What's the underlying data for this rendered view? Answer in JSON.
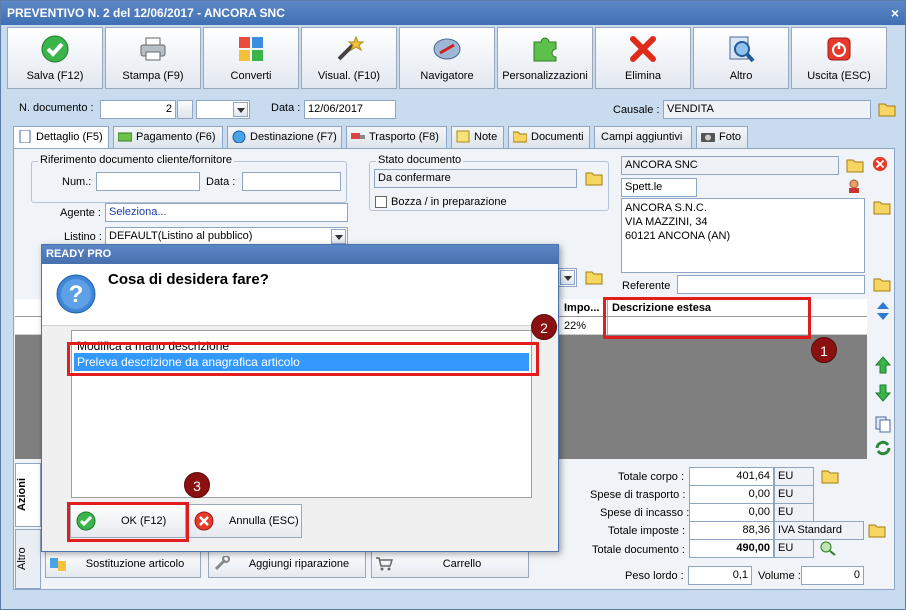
{
  "window": {
    "title": "PREVENTIVO N. 2 del 12/06/2017 - ANCORA SNC",
    "close_glyph": "×"
  },
  "toolbar": [
    {
      "name": "salva-button",
      "label": "Salva (F12)",
      "icon": "check-icon"
    },
    {
      "name": "stampa-button",
      "label": "Stampa (F9)",
      "icon": "printer-icon"
    },
    {
      "name": "converti-button",
      "label": "Converti",
      "icon": "convert-icon"
    },
    {
      "name": "visual-button",
      "label": "Visual. (F10)",
      "icon": "magic-wand-icon"
    },
    {
      "name": "navigatore-button",
      "label": "Navigatore",
      "icon": "compass-icon"
    },
    {
      "name": "personalizzazioni-button",
      "label": "Personalizzazioni",
      "icon": "puzzle-icon"
    },
    {
      "name": "elimina-button",
      "label": "Elimina",
      "icon": "red-x-icon"
    },
    {
      "name": "altro-button",
      "label": "Altro",
      "icon": "magnifier-icon"
    },
    {
      "name": "uscita-button",
      "label": "Uscita (ESC)",
      "icon": "power-icon"
    }
  ],
  "doc": {
    "ndoc_label": "N. documento :",
    "ndoc_value": "2",
    "data_label": "Data :",
    "data_value": "12/06/2017",
    "causale_label": "Causale :",
    "causale_value": "VENDITA"
  },
  "tabs": [
    "Dettaglio (F5)",
    "Pagamento (F6)",
    "Destinazione (F7)",
    "Trasporto (F8)",
    "Note",
    "Documenti",
    "Campi aggiuntivi",
    "Foto"
  ],
  "rif": {
    "title": "Riferimento documento cliente/fornitore",
    "num_label": "Num.:",
    "data_label": "Data :"
  },
  "stato": {
    "title": "Stato documento",
    "value": "Da confermare",
    "bozza_label": "Bozza / in preparazione"
  },
  "agente": {
    "label": "Agente :",
    "value": "Seleziona..."
  },
  "listino": {
    "label": "Listino :",
    "value": "DEFAULT(Listino al pubblico)"
  },
  "cliente": {
    "name": "ANCORA SNC",
    "title": "Spett.le",
    "address_lines": [
      "ANCORA S.N.C.",
      "VIA MAZZINI, 34",
      "60121 ANCONA (AN)"
    ],
    "referente_label": "Referente"
  },
  "grid": {
    "col_impo": "Impo...",
    "col_desc": "Descrizione estesa",
    "impo_value": "22%"
  },
  "totals": [
    {
      "label": "Totale corpo :",
      "value": "401,64",
      "unit": "EU"
    },
    {
      "label": "Spese di trasporto :",
      "value": "0,00",
      "unit": "EU"
    },
    {
      "label": "Spese di incasso :",
      "value": "0,00",
      "unit": "EU"
    },
    {
      "label": "Totale imposte :",
      "value": "88,36",
      "unit": "IVA Standard"
    },
    {
      "label": "Totale documento :",
      "value": "490,00",
      "unit": "EU"
    }
  ],
  "peso": {
    "lordo_label": "Peso lordo :",
    "lordo_value": "0,1",
    "volume_label": "Volume :",
    "volume_value": "0"
  },
  "side_tabs": {
    "azioni": "Azioni",
    "altro": "Altro"
  },
  "actions": {
    "sostituzione": "Sostituzione articolo",
    "riparazione": "Aggiungi riparazione",
    "carrello": "Carrello"
  },
  "markers": {
    "m1": "1",
    "m2": "2",
    "m3": "3"
  },
  "dialog": {
    "title": "READY PRO",
    "question": "Cosa di desidera fare?",
    "options": [
      "Modifica a mano descrizione",
      "Preleva descrizione da anagrafica articolo"
    ],
    "selected_index": 1,
    "ok_label": "OK (F12)",
    "cancel_label": "Annulla (ESC)"
  },
  "colors": {
    "titlebar": "#4b78bb",
    "highlight": "#e21d1d",
    "selection": "#3399ff",
    "marker": "#8b1111"
  }
}
